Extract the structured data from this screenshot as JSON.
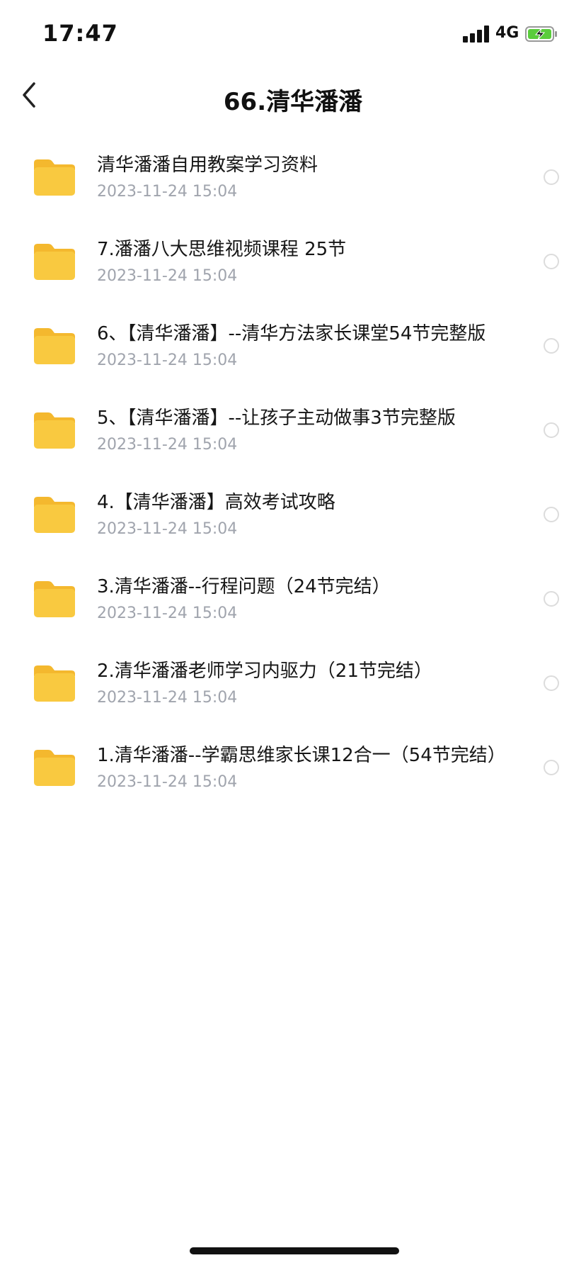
{
  "status_bar": {
    "time": "17:47",
    "network": "4G",
    "icons": [
      "signal-icon",
      "battery-charging-icon"
    ]
  },
  "nav": {
    "title": "66.清华潘潘",
    "back_icon": "chevron-left-icon"
  },
  "items": [
    {
      "title": "清华潘潘自用教案学习资料",
      "date": "2023-11-24 15:04"
    },
    {
      "title": "7.潘潘八大思维视频课程  25节",
      "date": "2023-11-24 15:04"
    },
    {
      "title": "6、【清华潘潘】--清华方法家长课堂54节完整版",
      "date": "2023-11-24 15:04"
    },
    {
      "title": "5、【清华潘潘】--让孩子主动做事3节完整版",
      "date": "2023-11-24 15:04"
    },
    {
      "title": "4.【清华潘潘】高效考试攻略",
      "date": "2023-11-24 15:04"
    },
    {
      "title": "3.清华潘潘--行程问题（24节完结）",
      "date": "2023-11-24 15:04"
    },
    {
      "title": "2.清华潘潘老师学习内驱力（21节完结）",
      "date": "2023-11-24 15:04"
    },
    {
      "title": "1.清华潘潘--学霸思维家长课12合一（54节完结）",
      "date": "2023-11-24 15:04"
    }
  ],
  "colors": {
    "folder": "#F9C940",
    "date_text": "#A0A4AD",
    "battery_fill": "#5ACC3C"
  }
}
